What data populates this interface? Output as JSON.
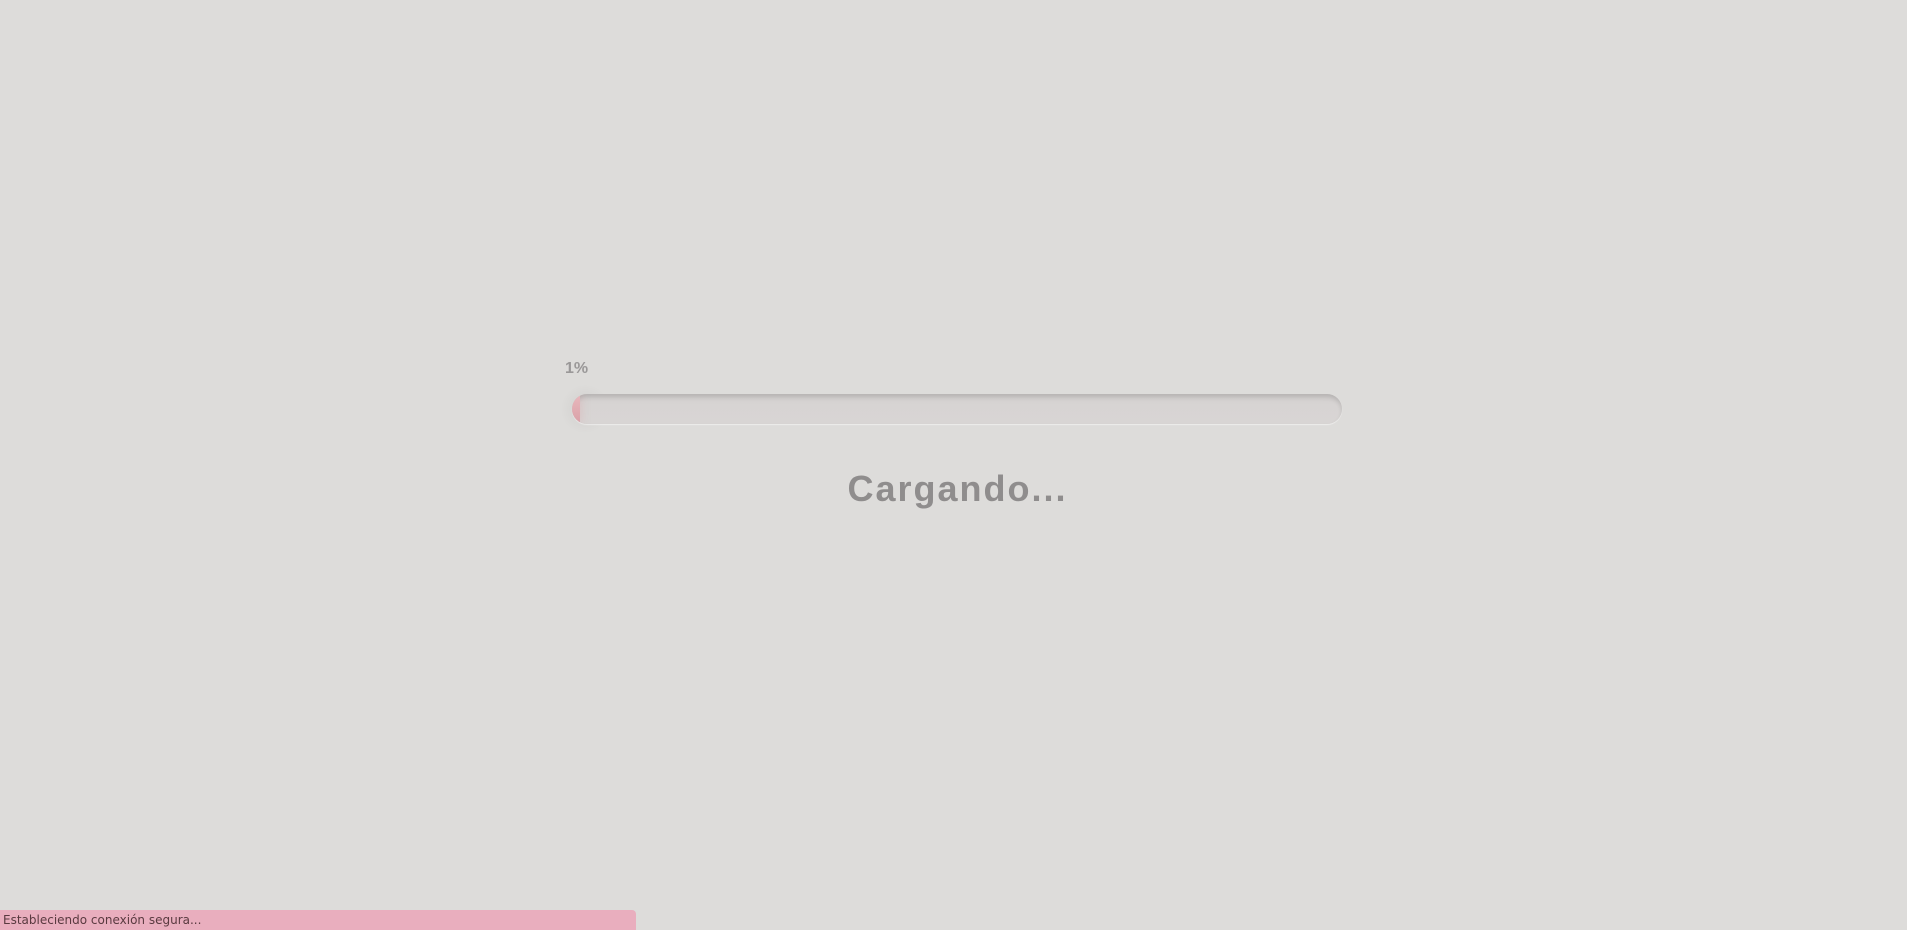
{
  "loader": {
    "percent_label": "1%",
    "progress": 0.01,
    "loading_text": "Cargando...",
    "fill_color": "#e2aab1",
    "track_color": "#d7d4d3"
  },
  "status_bar": {
    "text": "Estableciendo conexión segura..."
  },
  "colors": {
    "background": "#dddcda",
    "status_bar_bg": "#e9aebe",
    "text_gray": "#8f8d8d"
  }
}
